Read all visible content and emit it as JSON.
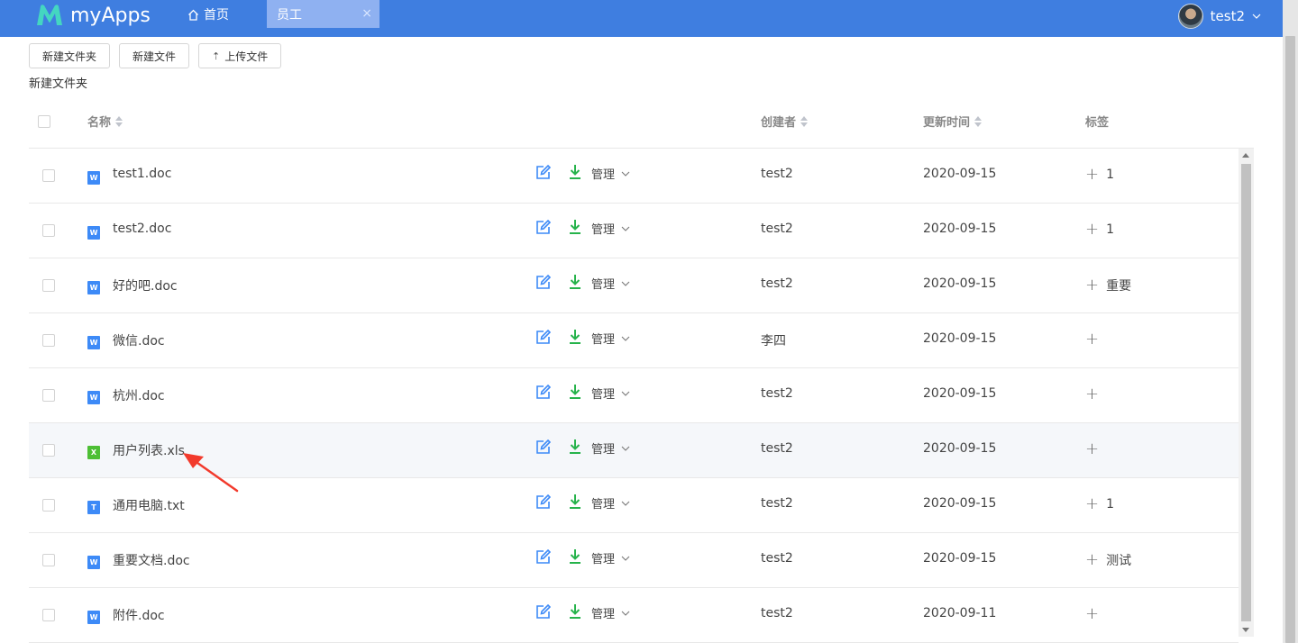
{
  "header": {
    "brand": "myApps",
    "nav_home": "首页",
    "active_tab": "员工",
    "tab_close": "×",
    "user_name": "test2",
    "accent_color": "#3f7ee0"
  },
  "toolbar": {
    "new_folder": "新建文件夹",
    "new_file": "新建文件",
    "upload": "上传文件"
  },
  "breadcrumb": "新建文件夹",
  "table": {
    "columns": {
      "name": "名称",
      "creator": "创建者",
      "updated": "更新时间",
      "tags": "标签"
    },
    "manage_label": "管理",
    "rows": [
      {
        "name": "test1.doc",
        "type": "word",
        "icon_letter": "W",
        "creator": "test2",
        "date": "2020-09-15",
        "tag": "1",
        "highlight": false
      },
      {
        "name": "test2.doc",
        "type": "word",
        "icon_letter": "W",
        "creator": "test2",
        "date": "2020-09-15",
        "tag": "1",
        "highlight": false
      },
      {
        "name": "好的吧.doc",
        "type": "word",
        "icon_letter": "W",
        "creator": "test2",
        "date": "2020-09-15",
        "tag": "重要",
        "highlight": false
      },
      {
        "name": "微信.doc",
        "type": "word",
        "icon_letter": "W",
        "creator": "李四",
        "date": "2020-09-15",
        "tag": "",
        "highlight": false
      },
      {
        "name": "杭州.doc",
        "type": "word",
        "icon_letter": "W",
        "creator": "test2",
        "date": "2020-09-15",
        "tag": "",
        "highlight": false
      },
      {
        "name": "用户列表.xls",
        "type": "excel",
        "icon_letter": "X",
        "creator": "test2",
        "date": "2020-09-15",
        "tag": "",
        "highlight": true
      },
      {
        "name": "通用电脑.txt",
        "type": "text",
        "icon_letter": "T",
        "creator": "test2",
        "date": "2020-09-15",
        "tag": "1",
        "highlight": false
      },
      {
        "name": "重要文档.doc",
        "type": "word",
        "icon_letter": "W",
        "creator": "test2",
        "date": "2020-09-15",
        "tag": "测试",
        "highlight": false
      },
      {
        "name": "附件.doc",
        "type": "word",
        "icon_letter": "W",
        "creator": "test2",
        "date": "2020-09-11",
        "tag": "",
        "highlight": false
      }
    ]
  },
  "icons": {
    "edit": "edit-icon",
    "download": "download-icon",
    "chevron": "chevron-down-icon",
    "plus": "plus-icon",
    "sort": "sort-icon"
  },
  "colors": {
    "edit_icon": "#3d8af7",
    "download_icon": "#26b34b",
    "annotation_arrow": "#f23a2c"
  }
}
